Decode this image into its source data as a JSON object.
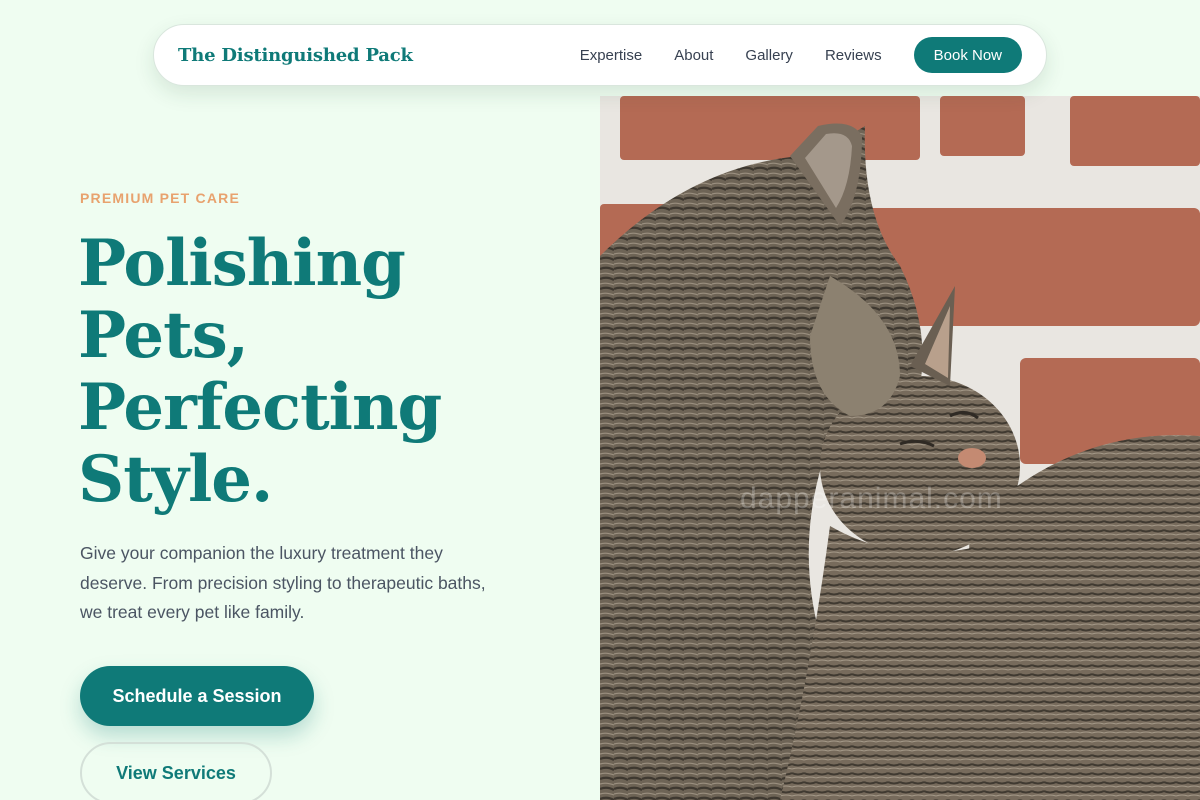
{
  "nav": {
    "brand": "The Distinguished Pack",
    "links": [
      "Expertise",
      "About",
      "Gallery",
      "Reviews"
    ],
    "cta": "Book Now"
  },
  "hero": {
    "eyebrow": "PREMIUM PET CARE",
    "headline_lines": [
      "Polishing",
      "Pets,",
      "Perfecting",
      "Style."
    ],
    "lead": "Give your companion the luxury treatment they deserve. From precision styling to therapeutic baths, we treat every pet like family.",
    "primary_button": "Schedule a Session",
    "secondary_button": "View Services",
    "image_watermark": "dapperanimal.com"
  },
  "colors": {
    "background": "#effdf1",
    "brand_teal": "#0f7a78",
    "accent_orange": "#e8a26e",
    "text_gray": "#4b5563"
  }
}
